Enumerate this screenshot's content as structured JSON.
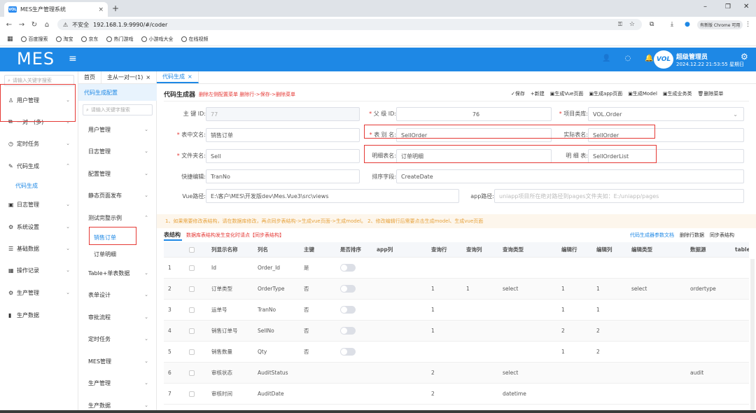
{
  "browser": {
    "tab_title": "MES生产管理系统",
    "favicon_text": "VOL",
    "security": "不安全",
    "url": "192.168.1.9:9990/#/coder",
    "profile": "有新版 Chrome 可用",
    "bookmarks": [
      "百度搜索",
      "淘宝",
      "京东",
      "热门游戏",
      "小游戏大全",
      "在线视频"
    ]
  },
  "header": {
    "logo": "MES",
    "user_name": "超级管理员",
    "datetime": "2024.12.22 21:53:55 星期日",
    "avatar_text": "VOL"
  },
  "sidebar": {
    "search_placeholder": "请输入关键字搜索",
    "items": [
      {
        "label": "用户管理",
        "icon": "user-icon"
      },
      {
        "label": "一对一(多)",
        "icon": "copy-icon"
      },
      {
        "label": "定时任务",
        "icon": "clock-icon"
      },
      {
        "label": "代码生成",
        "icon": "edit-icon"
      },
      {
        "label": "代码生成",
        "icon": ""
      },
      {
        "label": "日志管理",
        "icon": "calendar-icon"
      },
      {
        "label": "系统设置",
        "icon": "settings-icon"
      },
      {
        "label": "基础数据",
        "icon": "sliders-icon"
      },
      {
        "label": "操作记录",
        "icon": "grid-icon"
      },
      {
        "label": "生产管理",
        "icon": "gear-icon"
      },
      {
        "label": "生产数据",
        "icon": "bar-chart-icon"
      }
    ]
  },
  "tabs": [
    {
      "label": "首页"
    },
    {
      "label": "主从一对一(1)"
    },
    {
      "label": "代码生成"
    }
  ],
  "subnav": {
    "title": "代码生成配置",
    "search_placeholder": "请输入关键字搜索",
    "items": [
      "用户管理",
      "日志管理",
      "配置管理",
      "静态页面发布",
      "测试完整示例",
      "销售订单",
      "订单明细",
      "Table+单表数据",
      "表单设计",
      "审批流程",
      "定时任务",
      "MES管理",
      "生产管理",
      "生产数据"
    ]
  },
  "generator": {
    "title": "代码生成器",
    "warning": "删除左侧配置菜单 删除行->保存->删除菜单",
    "actions": [
      "保存",
      "新建",
      "生成Vue页面",
      "生成app页面",
      "生成Model",
      "生成业务类",
      "删除菜单"
    ],
    "fields": {
      "primary_key_label": "主 键 ID:",
      "primary_key": "77",
      "parent_id_label": "父 级 ID:",
      "parent_id": "76",
      "project_type_label": "项目类库:",
      "project_type": "VOL.Order",
      "cn_name_label": "表中文名:",
      "cn_name": "销售订单",
      "alias_label": "表 别 名:",
      "alias": "SellOrder",
      "real_name_label": "实际表名:",
      "real_name": "SellOrder",
      "folder_label": "文件夹名:",
      "folder": "Sell",
      "detail_cn_label": "明细表名:",
      "detail_cn": "订单明细",
      "detail_label": "明 细 表:",
      "detail": "SellOrderList",
      "quick_edit_label": "快捷编辑:",
      "quick_edit": "TranNo",
      "sort_label": "排序字段:",
      "sort": "CreateDate",
      "vue_path_label": "Vue路径:",
      "vue_path": "E:\\客户\\MES\\开发版dev\\Mes.Vue3\\src\\views",
      "app_path_label": "app路径:",
      "app_path_placeholder": "uniapp项目所在绝对路径到pages文件夹如：E:/uniapp/pages"
    },
    "tip": "1、如果需要修改表结构，请在数据库修改，再点同步表结构->生成vue页面->生成model。 2、修改编辑行后需要点击生成model、生成vue页面"
  },
  "table_section": {
    "title": "表结构",
    "warning": "数据库表结构发生变化时请点【同步表结构】",
    "links": [
      "代码生成器参数文档",
      "删除行数据",
      "同步表结构"
    ],
    "columns": [
      "列显示名称",
      "列名",
      "主键",
      "是否排序",
      "app列",
      "查询行",
      "查询列",
      "查询类型",
      "编辑行",
      "编辑列",
      "编辑类型",
      "数据源",
      "table"
    ],
    "rows": [
      {
        "n": "1",
        "display": "Id",
        "name": "Order_Id",
        "pk": "是",
        "qrow": "",
        "qcol": "",
        "qtype": "",
        "erow": "",
        "ecol": "",
        "etype": "",
        "src": ""
      },
      {
        "n": "2",
        "display": "订单类型",
        "name": "OrderType",
        "pk": "否",
        "qrow": "1",
        "qcol": "1",
        "qtype": "select",
        "erow": "1",
        "ecol": "1",
        "etype": "select",
        "src": "ordertype"
      },
      {
        "n": "3",
        "display": "运单号",
        "name": "TranNo",
        "pk": "否",
        "qrow": "1",
        "qcol": "",
        "qtype": "",
        "erow": "1",
        "ecol": "1",
        "etype": "",
        "src": ""
      },
      {
        "n": "4",
        "display": "销售订单号",
        "name": "SellNo",
        "pk": "否",
        "qrow": "1",
        "qcol": "",
        "qtype": "",
        "erow": "2",
        "ecol": "2",
        "etype": "",
        "src": ""
      },
      {
        "n": "5",
        "display": "销售数量",
        "name": "Qty",
        "pk": "否",
        "qrow": "",
        "qcol": "",
        "qtype": "",
        "erow": "1",
        "ecol": "2",
        "etype": "",
        "src": ""
      },
      {
        "n": "6",
        "display": "审核状态",
        "name": "AuditStatus",
        "pk": "",
        "qrow": "2",
        "qcol": "",
        "qtype": "select",
        "erow": "",
        "ecol": "",
        "etype": "",
        "src": "audit"
      },
      {
        "n": "7",
        "display": "审核时间",
        "name": "AuditDate",
        "pk": "",
        "qrow": "2",
        "qcol": "",
        "qtype": "datetime",
        "erow": "",
        "ecol": "",
        "etype": "",
        "src": ""
      }
    ]
  },
  "colors": {
    "primary": "#1e88e5",
    "danger": "#e53935",
    "warning": "#e6a23c"
  }
}
